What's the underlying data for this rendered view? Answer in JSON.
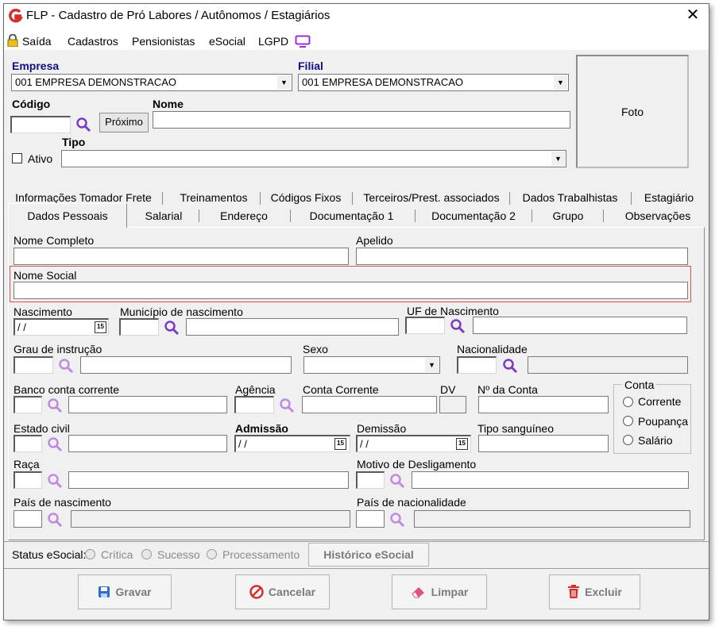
{
  "window": {
    "title": "FLP - Cadastro de Pró Labores / Autônomos / Estagiários"
  },
  "menu": {
    "items": [
      "Saída",
      "Cadastros",
      "Pensionistas",
      "eSocial",
      "LGPD"
    ]
  },
  "header": {
    "empresa_label": "Empresa",
    "empresa_value": "001 EMPRESA DEMONSTRACAO",
    "filial_label": "Filial",
    "filial_value": "001 EMPRESA DEMONSTRACAO",
    "codigo_label": "Código",
    "codigo_value": "",
    "proximo_label": "Próximo",
    "nome_label": "Nome",
    "nome_value": "",
    "ativo_label": "Ativo",
    "tipo_label": "Tipo",
    "tipo_value": "",
    "foto_label": "Foto"
  },
  "tabs_row1": [
    "Informações Tomador Frete",
    "Treinamentos",
    "Códigos Fixos",
    "Terceiros/Prest. associados",
    "Dados Trabalhistas",
    "Estagiário"
  ],
  "tabs_row2": [
    "Dados Pessoais",
    "Salarial",
    "Endereço",
    "Documentação 1",
    "Documentação 2",
    "Grupo",
    "Observações"
  ],
  "form": {
    "nome_completo": "Nome Completo",
    "apelido": "Apelido",
    "nome_social": "Nome Social",
    "nascimento": "Nascimento",
    "nascimento_value": " / /",
    "municipio": "Município de nascimento",
    "uf": "UF de Nascimento",
    "grau": "Grau de instrução",
    "sexo": "Sexo",
    "nacionalidade": "Nacionalidade",
    "banco": "Banco conta corrente",
    "agencia": "Agência",
    "conta_corrente": "Conta Corrente",
    "dv": "DV",
    "num_conta": "Nº da Conta",
    "conta_group": "Conta",
    "conta_options": [
      "Corrente",
      "Poupança",
      "Salário"
    ],
    "estado_civil": "Estado civil",
    "admissao": "Admissão",
    "admissao_value": " / /",
    "demissao": "Demissão",
    "demissao_value": " / /",
    "tipo_sanguineo": "Tipo sanguíneo",
    "raca": "Raça",
    "motivo": "Motivo de Desligamento",
    "pais_nasc": "País de nascimento",
    "pais_nac": "País de nacionalidade"
  },
  "status": {
    "label": "Status eSocial:",
    "items": [
      "Crítica",
      "Sucesso",
      "Processamento"
    ],
    "historico": "Histórico eSocial"
  },
  "actions": {
    "gravar": "Gravar",
    "cancelar": "Cancelar",
    "limpar": "Limpar",
    "excluir": "Excluir"
  },
  "colors": {
    "highlight_border": "#d9534f",
    "magnifier": "#7a3cc2",
    "magnifier_disabled": "#c08ae0",
    "brand_red": "#d32f2f"
  }
}
